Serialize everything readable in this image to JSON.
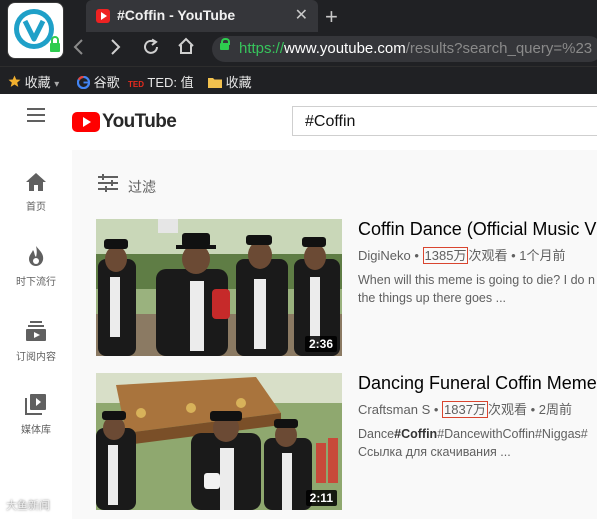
{
  "browser": {
    "tab_title": "#Coffin - YouTube",
    "tab_close": "✕",
    "new_tab": "+",
    "url_scheme": "https://",
    "url_host": "www.youtube.com",
    "url_path": "/results?search_query=%23",
    "bookmarks": [
      {
        "label": "收藏",
        "icon": "star-icon"
      },
      {
        "label": "谷歌",
        "icon": "google-icon"
      },
      {
        "label": "TED: 值",
        "icon": "ted-icon"
      },
      {
        "label": "收藏",
        "icon": "folder-icon"
      }
    ]
  },
  "youtube": {
    "logo_text": "YouTube",
    "search_value": "#Coffin",
    "guide": [
      {
        "label": "首页",
        "icon": "home-icon"
      },
      {
        "label": "时下流行",
        "icon": "flame-icon"
      },
      {
        "label": "订阅内容",
        "icon": "subscriptions-icon"
      },
      {
        "label": "媒体库",
        "icon": "library-icon"
      }
    ],
    "filter_label": "过滤",
    "videos": [
      {
        "title": "Coffin Dance (Official Music V",
        "channel": "DigiNeko",
        "views": "1385万",
        "views_suffix": "次观看",
        "age": "1个月前",
        "desc": "When will this meme is going to die? I do n the things up there goes ...",
        "duration": "2:36"
      },
      {
        "title": "Dancing Funeral Coffin Meme",
        "channel": "Craftsman S",
        "views": "1837万",
        "views_suffix": "次观看",
        "age": "2周前",
        "desc_parts": [
          "Dance",
          "#Coffin",
          "#DancewithCoffin#Niggas#"
        ],
        "desc_line2": "Ссылка для скачивания ...",
        "duration": "2:11"
      }
    ]
  },
  "watermark": "大鱼新闻",
  "colors": {
    "accent_red": "#ff0000",
    "highlight_box": "#d9452f",
    "url_green": "#37c45c"
  }
}
